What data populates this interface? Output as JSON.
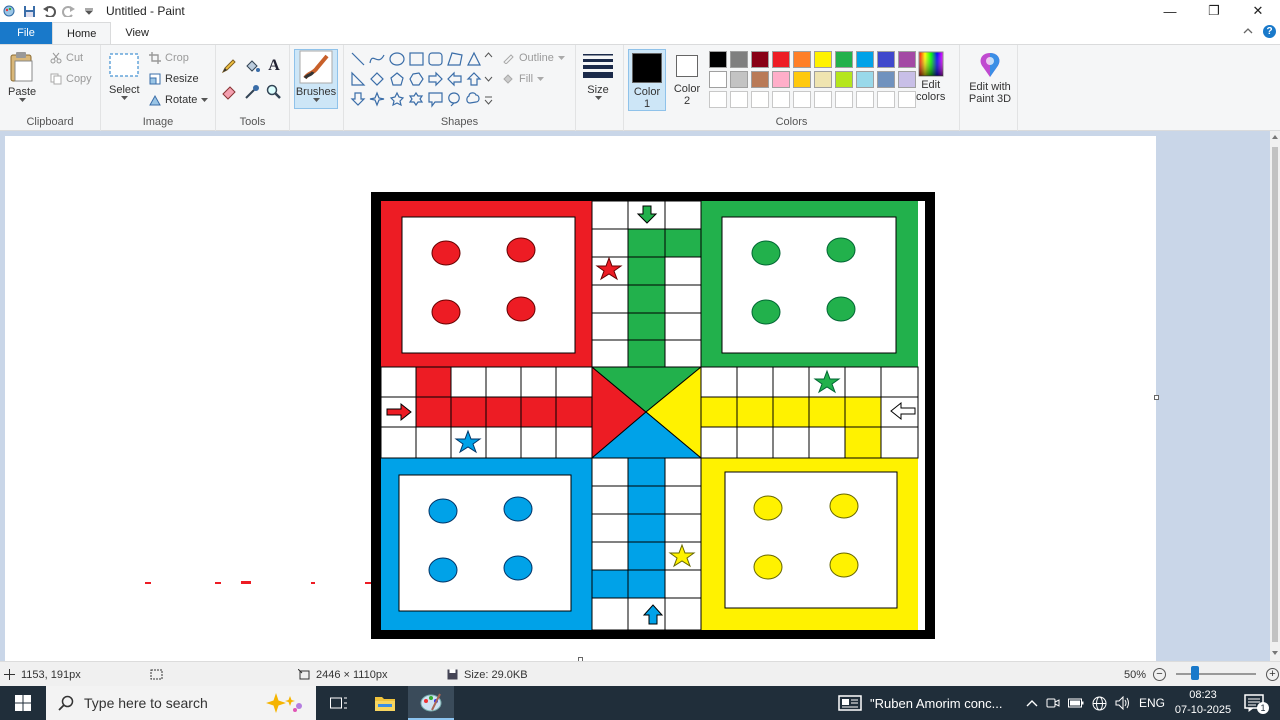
{
  "window": {
    "title": "Untitled - Paint",
    "minimize": "—",
    "restore": "❐",
    "close": "✕"
  },
  "tabs": [
    {
      "label": "File"
    },
    {
      "label": "Home"
    },
    {
      "label": "View"
    }
  ],
  "ribbon": {
    "clipboard": {
      "label": "Clipboard",
      "paste": "Paste",
      "cut": "Cut",
      "copy": "Copy"
    },
    "image": {
      "label": "Image",
      "select": "Select",
      "crop": "Crop",
      "resize": "Resize",
      "rotate": "Rotate"
    },
    "tools": {
      "label": "Tools"
    },
    "brushes": {
      "label": "Brushes"
    },
    "shapes": {
      "label": "Shapes",
      "outline": "Outline",
      "fill": "Fill"
    },
    "size": {
      "label": "Size"
    },
    "colors": {
      "label": "Colors",
      "color1": "Color\n1",
      "color1_line1": "Color",
      "color1_line2": "1",
      "color2_line1": "Color",
      "color2_line2": "2",
      "edit_colors_line1": "Edit",
      "edit_colors_line2": "colors",
      "palette_row1": [
        "#000000",
        "#7f7f7f",
        "#880015",
        "#ed1c24",
        "#ff7f27",
        "#fff200",
        "#22b14c",
        "#00a2e8",
        "#3f48cc",
        "#a349a4"
      ],
      "palette_row2": [
        "#ffffff",
        "#c3c3c3",
        "#b97a57",
        "#ffaec9",
        "#ffc90e",
        "#efe4b0",
        "#b5e61d",
        "#99d9ea",
        "#7092be",
        "#c8bfe7"
      ],
      "primary": "#000000",
      "secondary": "#ffffff"
    },
    "paint3d": {
      "line1": "Edit with",
      "line2": "Paint 3D"
    }
  },
  "board": {
    "red": "#ed1c24",
    "green": "#22b14c",
    "yellow": "#fff200",
    "blue": "#00a2e8",
    "border": "#000000"
  },
  "status": {
    "cursor_pos": "1153, 191px",
    "image_size": "2446 × 1110px",
    "file_size": "Size: 29.0KB",
    "zoom": "50%",
    "zoom_out": "−",
    "zoom_in": "+"
  },
  "taskbar": {
    "search_placeholder": "Type here to search",
    "news": "\"Ruben Amorim conc...",
    "language": "ENG",
    "time": "08:23",
    "date": "07-10-2025"
  }
}
